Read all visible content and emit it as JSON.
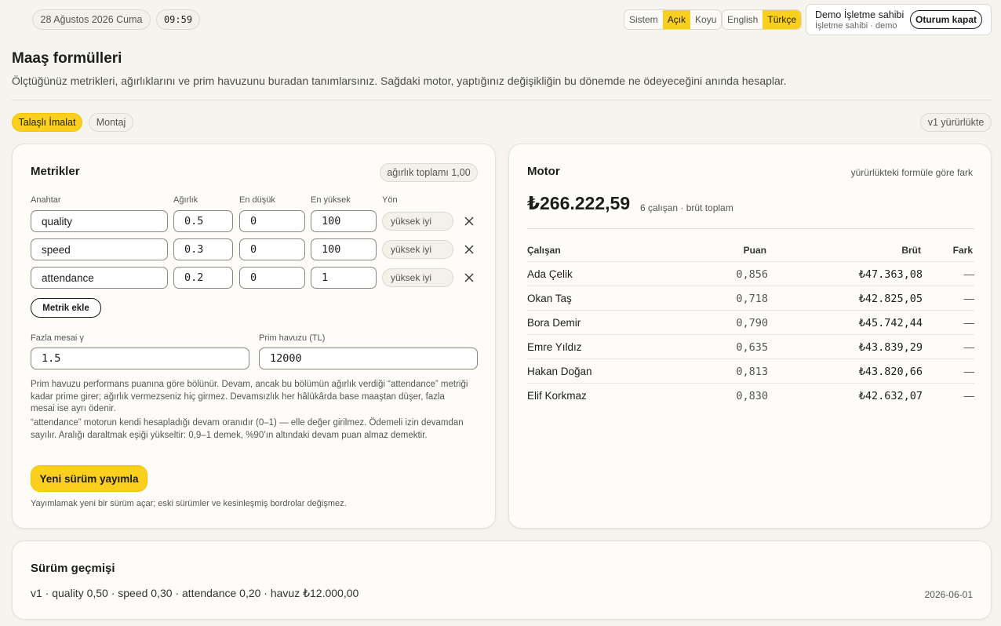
{
  "topbar": {
    "date": "28 Ağustos 2026 Cuma",
    "time": "09:59",
    "theme_options": [
      "Sistem",
      "Açık",
      "Koyu"
    ],
    "theme_active": "Açık",
    "language_options": [
      "English",
      "Türkçe"
    ],
    "language_active": "Türkçe",
    "user_name": "Demo İşletme sahibi",
    "user_role": "İşletme sahibi · demo",
    "logout_label": "Oturum kapat"
  },
  "page": {
    "title": "Maaş formülleri",
    "description": "Ölçtüğünüz metrikleri, ağırlıklarını ve prim havuzunu buradan tanımlarsınız. Sağdaki motor, yaptığınız değişikliğin bu dönemde ne ödeyeceğini anında hesaplar."
  },
  "tabs": [
    {
      "label": "Talaşlı İmalat",
      "active": true
    },
    {
      "label": "Montaj",
      "active": false
    }
  ],
  "version_status": "v1 yürürlükte",
  "metrics_card": {
    "title": "Metrikler",
    "weight_total": "ağırlık toplamı 1,00",
    "columns": {
      "key": "Anahtar",
      "weight": "Ağırlık",
      "min": "En düşük",
      "max": "En yüksek",
      "direction": "Yön"
    },
    "rows": [
      {
        "key": "quality",
        "weight": "0.5",
        "min": "0",
        "max": "100",
        "direction": "yüksek iyi"
      },
      {
        "key": "speed",
        "weight": "0.3",
        "min": "0",
        "max": "100",
        "direction": "yüksek iyi"
      },
      {
        "key": "attendance",
        "weight": "0.2",
        "min": "0",
        "max": "1",
        "direction": "yüksek iyi"
      }
    ],
    "add_metric_label": "Metrik ekle",
    "overtime_label": "Fazla mesai γ",
    "overtime_value": "1.5",
    "bonus_pool_label": "Prim havuzu (TL)",
    "bonus_pool_value": "12000",
    "help_1": "Prim havuzu performans puanına göre bölünür. Devam, ancak bu bölümün ağırlık verdiği “attendance” metriği kadar prime girer; ağırlık vermezseniz hiç girmez. Devamsızlık her hâlükârda base maaştan düşer, fazla mesai ise ayrı ödenir.",
    "help_2": "“attendance” motorun kendi hesapladığı devam oranıdır (0–1) — elle değer girilmez. Ödemeli izin devamdan sayılır. Aralığı daraltmak eşiği yükseltir: 0,9–1 demek, %90’ın altındaki devam puan almaz demektir.",
    "publish_label": "Yeni sürüm yayımla",
    "publish_note": "Yayımlamak yeni bir sürüm açar; eski sürümler ve kesinleşmiş bordrolar değişmez."
  },
  "engine_card": {
    "title": "Motor",
    "diff_note": "yürürlükteki formüle göre fark",
    "total": "₺266.222,59",
    "total_sub": "6 çalışan · brüt toplam",
    "columns": {
      "employee": "Çalışan",
      "score": "Puan",
      "gross": "Brüt",
      "diff": "Fark"
    },
    "rows": [
      {
        "name": "Ada Çelik",
        "score": "0,856",
        "gross": "₺47.363,08",
        "diff": "—"
      },
      {
        "name": "Okan Taş",
        "score": "0,718",
        "gross": "₺42.825,05",
        "diff": "—"
      },
      {
        "name": "Bora Demir",
        "score": "0,790",
        "gross": "₺45.742,44",
        "diff": "—"
      },
      {
        "name": "Emre Yıldız",
        "score": "0,635",
        "gross": "₺43.839,29",
        "diff": "—"
      },
      {
        "name": "Hakan Doğan",
        "score": "0,813",
        "gross": "₺43.820,66",
        "diff": "—"
      },
      {
        "name": "Elif Korkmaz",
        "score": "0,830",
        "gross": "₺42.632,07",
        "diff": "—"
      }
    ]
  },
  "history_card": {
    "title": "Sürüm geçmişi",
    "entries": [
      {
        "summary": "v1 · quality 0,50 · speed 0,30 · attendance 0,20 · havuz ₺12.000,00",
        "date": "2026-06-01"
      }
    ]
  },
  "colors": {
    "accent": "#fbcf1d",
    "background": "#f6f4ee",
    "card": "#fdfcf8"
  },
  "icons": {
    "remove": "close-icon"
  }
}
